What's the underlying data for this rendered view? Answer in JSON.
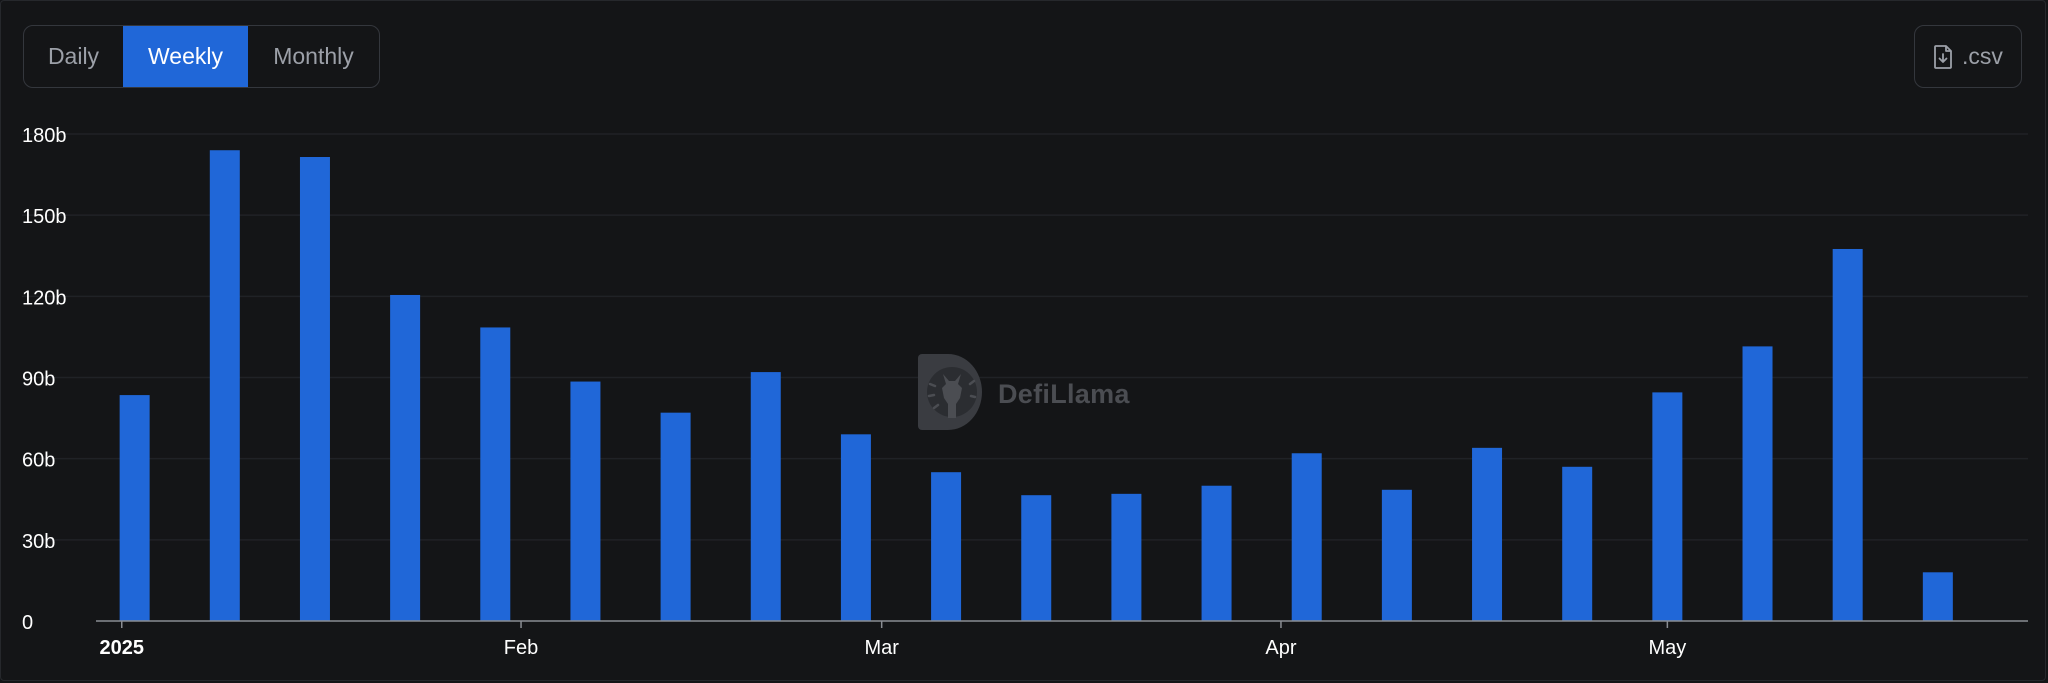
{
  "controls": {
    "intervals": [
      "Daily",
      "Weekly",
      "Monthly"
    ],
    "selected": "Weekly",
    "csv_label": ".csv"
  },
  "watermark": {
    "text": "DefiLlama"
  },
  "colors": {
    "background": "#141517",
    "bar": "#2067d8",
    "grid": "#202226",
    "axis_text": "#ffffff",
    "button_border": "#34373d"
  },
  "chart_data": {
    "type": "bar",
    "title": "",
    "xlabel": "",
    "ylabel": "",
    "ylim": [
      0,
      180
    ],
    "y_unit": "billions",
    "y_ticks": [
      {
        "value": 0,
        "label": "0"
      },
      {
        "value": 30,
        "label": "30b"
      },
      {
        "value": 60,
        "label": "60b"
      },
      {
        "value": 90,
        "label": "90b"
      },
      {
        "value": 120,
        "label": "120b"
      },
      {
        "value": 150,
        "label": "150b"
      },
      {
        "value": 180,
        "label": "180b"
      }
    ],
    "x_ticks": [
      {
        "date": "2025-01-01",
        "label": "2025",
        "bold": true
      },
      {
        "date": "2025-02-01",
        "label": "Feb",
        "bold": false
      },
      {
        "date": "2025-03-01",
        "label": "Mar",
        "bold": false
      },
      {
        "date": "2025-04-01",
        "label": "Apr",
        "bold": false
      },
      {
        "date": "2025-05-01",
        "label": "May",
        "bold": false
      }
    ],
    "x_range": [
      "2024-12-30",
      "2025-05-29"
    ],
    "grid": true,
    "series": [
      {
        "x": [
          "2025-01-02",
          "2025-01-09",
          "2025-01-16",
          "2025-01-23",
          "2025-01-30",
          "2025-02-06",
          "2025-02-13",
          "2025-02-20",
          "2025-02-27",
          "2025-03-06",
          "2025-03-13",
          "2025-03-20",
          "2025-03-27",
          "2025-04-03",
          "2025-04-10",
          "2025-04-17",
          "2025-04-24",
          "2025-05-01",
          "2025-05-08",
          "2025-05-15",
          "2025-05-22"
        ],
        "values": [
          83.5,
          174,
          171.5,
          120.5,
          108.5,
          88.5,
          77,
          92,
          69,
          55,
          46.5,
          47,
          50,
          62,
          48.5,
          64,
          57,
          84.5,
          101.5,
          137.5,
          18
        ]
      }
    ]
  }
}
